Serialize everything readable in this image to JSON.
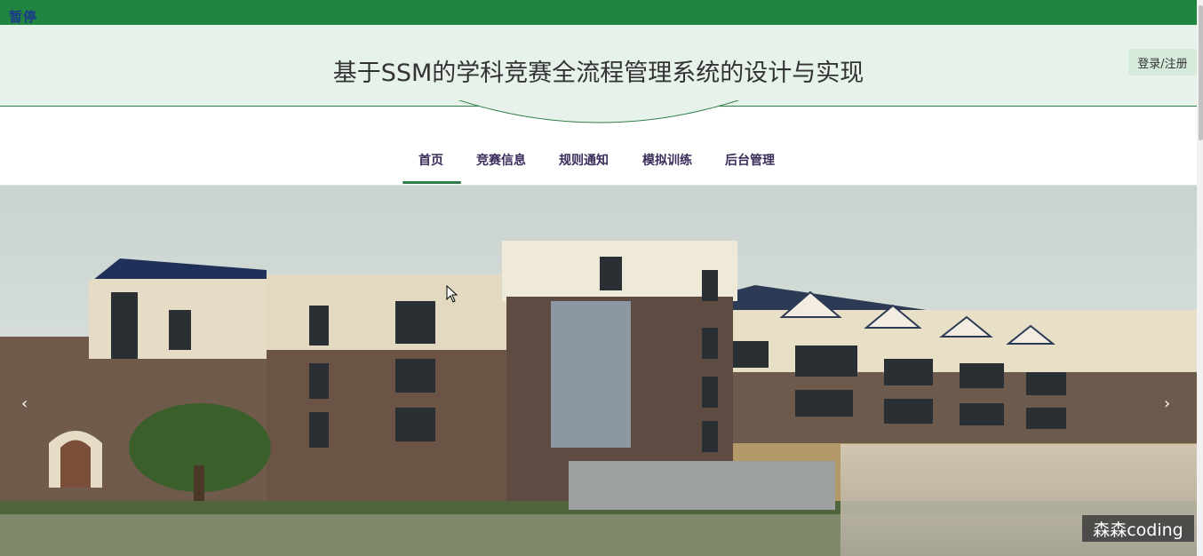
{
  "player_overlay": {
    "pause_label": "暂停"
  },
  "header": {
    "title": "基于SSM的学科竞赛全流程管理系统的设计与实现",
    "login_label": "登录/注册"
  },
  "nav": {
    "items": [
      "首页",
      "竞赛信息",
      "规则通知",
      "模拟训练",
      "后台管理"
    ],
    "active_index": 0
  },
  "carousel": {
    "prev_arrow": "‹",
    "next_arrow": "›"
  },
  "watermark": {
    "text": "森森coding"
  },
  "colors": {
    "topbar": "#1f8541",
    "header_bg": "#e6f2ea",
    "accent": "#2f7d4a",
    "nav_text": "#3b2c5a"
  }
}
